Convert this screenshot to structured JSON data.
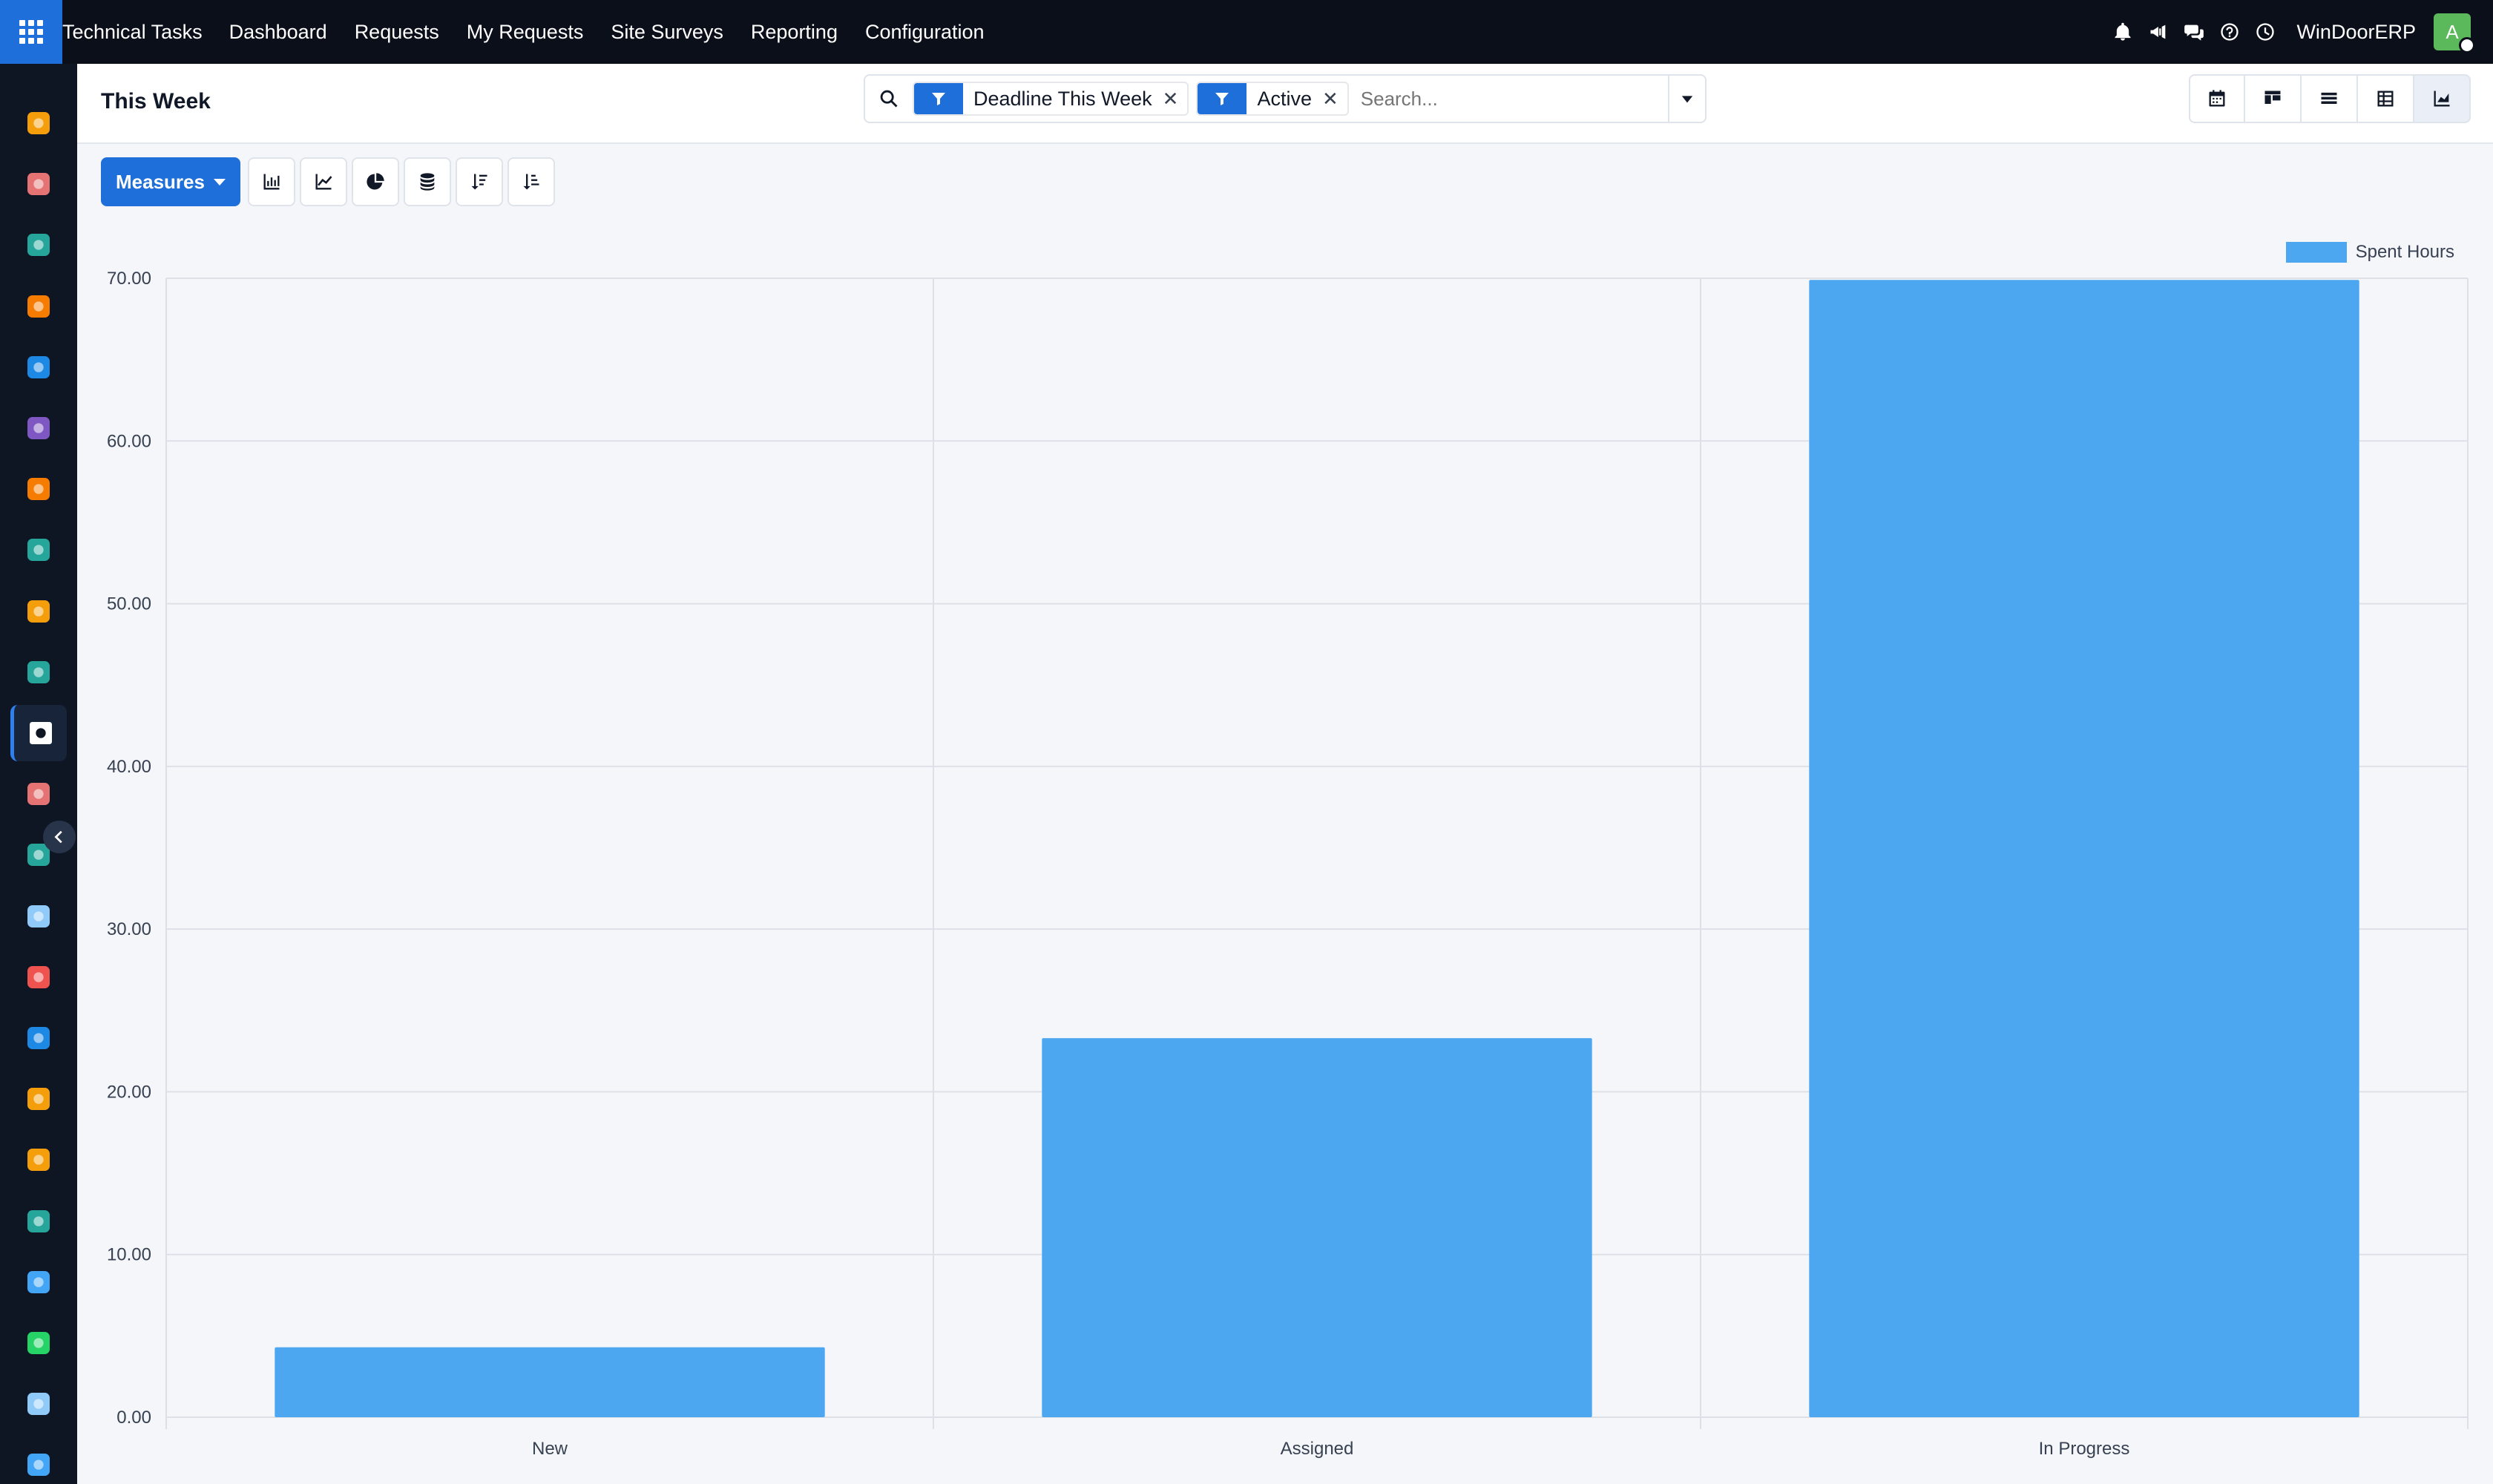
{
  "app": {
    "name": "Technical Tasks",
    "menu": [
      "Dashboard",
      "Requests",
      "My Requests",
      "Site Surveys",
      "Reporting",
      "Configuration"
    ],
    "company": "WinDoorERP",
    "avatar_initial": "A"
  },
  "top_icons": [
    "bell-icon",
    "megaphone-icon",
    "chat-icon",
    "help-icon",
    "clock-icon"
  ],
  "sidebar": {
    "apps": [
      {
        "icon": "chart-app-icon",
        "color": "#f59e0b"
      },
      {
        "icon": "crm-app-icon",
        "color": "#e57373"
      },
      {
        "icon": "contacts-app-icon",
        "color": "#26a69a"
      },
      {
        "icon": "discuss-app-icon",
        "color": "#f57c00"
      },
      {
        "icon": "website-app-icon",
        "color": "#1e88e5"
      },
      {
        "icon": "mail-app-icon",
        "color": "#7e57c2"
      },
      {
        "icon": "livechat-app-icon",
        "color": "#f57c00"
      },
      {
        "icon": "inventory-app-icon",
        "color": "#26a69a"
      },
      {
        "icon": "reporting-app-icon",
        "color": "#f59e0b"
      },
      {
        "icon": "employees-app-icon",
        "color": "#26a69a"
      },
      {
        "icon": "technical-tasks-app-icon",
        "color": "#ffffff",
        "active": true
      },
      {
        "icon": "sales-app-icon",
        "color": "#e57373"
      },
      {
        "icon": "project-app-icon",
        "color": "#26a69a"
      },
      {
        "icon": "knowledge-app-icon",
        "color": "#90caf9"
      },
      {
        "icon": "product-app-icon",
        "color": "#ef5350"
      },
      {
        "icon": "invoicing-app-icon",
        "color": "#1e88e5"
      },
      {
        "icon": "team-app-icon",
        "color": "#f59e0b"
      },
      {
        "icon": "calendar-app-icon",
        "color": "#f59e0b"
      },
      {
        "icon": "sign-app-icon",
        "color": "#26a69a"
      },
      {
        "icon": "dashboard-app-icon",
        "color": "#42a5f5"
      },
      {
        "icon": "whatsapp-app-icon",
        "color": "#25d366"
      },
      {
        "icon": "timer-app-icon",
        "color": "#90caf9"
      },
      {
        "icon": "sync-app-icon",
        "color": "#42a5f5"
      }
    ]
  },
  "control": {
    "title": "This Week",
    "facets": [
      {
        "label": "Deadline This Week",
        "remove": "✕"
      },
      {
        "label": "Active",
        "remove": "✕"
      }
    ],
    "search_placeholder": "Search...",
    "views": [
      "calendar-view-icon",
      "kanban-view-icon",
      "list-view-icon",
      "pivot-view-icon",
      "graph-view-icon"
    ],
    "active_view": "graph-view-icon"
  },
  "toolbar": {
    "measures_label": "Measures",
    "tools": [
      "bar-chart-icon",
      "line-chart-icon",
      "pie-chart-icon",
      "stacked-icon",
      "sort-descending-icon",
      "sort-ascending-icon"
    ]
  },
  "chart_data": {
    "type": "bar",
    "categories": [
      "New",
      "Assigned",
      "In Progress"
    ],
    "series": [
      {
        "name": "Spent Hours",
        "values": [
          4.3,
          23.3,
          69.9
        ],
        "color": "#4da6f0"
      }
    ],
    "ylim": [
      0,
      70
    ],
    "yticks": [
      "0.00",
      "10.00",
      "20.00",
      "30.00",
      "40.00",
      "50.00",
      "60.00",
      "70.00"
    ],
    "grid": true,
    "legend": "top-right"
  }
}
